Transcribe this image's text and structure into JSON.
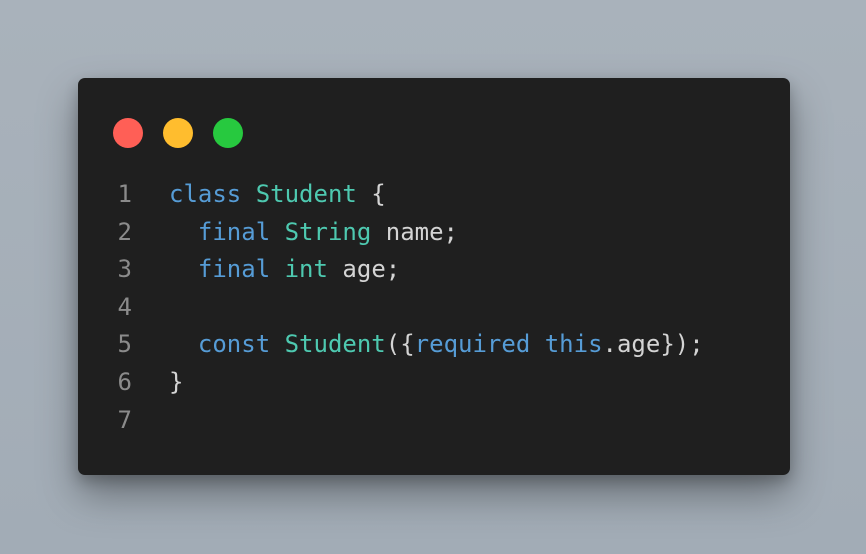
{
  "window": {
    "buttons": [
      {
        "name": "close",
        "color": "#ff5f56"
      },
      {
        "name": "minimize",
        "color": "#ffbd2e"
      },
      {
        "name": "maximize",
        "color": "#27c93f"
      }
    ]
  },
  "colors": {
    "keyword": "#569cd6",
    "type": "#4ec9b0",
    "identifier": "#d4d4d4",
    "line_number": "#8b8b8b",
    "background": "#1f1f1f"
  },
  "code": {
    "lines": [
      {
        "number": "1",
        "tokens": [
          {
            "text": "class",
            "kind": "kw"
          },
          {
            "text": " ",
            "kind": "pn"
          },
          {
            "text": "Student",
            "kind": "ty"
          },
          {
            "text": " {",
            "kind": "pn"
          }
        ]
      },
      {
        "number": "2",
        "tokens": [
          {
            "text": "  ",
            "kind": "pn"
          },
          {
            "text": "final",
            "kind": "kw"
          },
          {
            "text": " ",
            "kind": "pn"
          },
          {
            "text": "String",
            "kind": "ty"
          },
          {
            "text": " name;",
            "kind": "id"
          }
        ]
      },
      {
        "number": "3",
        "tokens": [
          {
            "text": "  ",
            "kind": "pn"
          },
          {
            "text": "final",
            "kind": "kw"
          },
          {
            "text": " ",
            "kind": "pn"
          },
          {
            "text": "int",
            "kind": "ty"
          },
          {
            "text": " age;",
            "kind": "id"
          }
        ]
      },
      {
        "number": "4",
        "tokens": []
      },
      {
        "number": "5",
        "tokens": [
          {
            "text": "  ",
            "kind": "pn"
          },
          {
            "text": "const",
            "kind": "kw"
          },
          {
            "text": " ",
            "kind": "pn"
          },
          {
            "text": "Student",
            "kind": "ty"
          },
          {
            "text": "({",
            "kind": "pn"
          },
          {
            "text": "required",
            "kind": "kw"
          },
          {
            "text": " ",
            "kind": "pn"
          },
          {
            "text": "this",
            "kind": "kw"
          },
          {
            "text": ".age});",
            "kind": "id"
          }
        ]
      },
      {
        "number": "6",
        "tokens": [
          {
            "text": "}",
            "kind": "pn"
          }
        ]
      },
      {
        "number": "7",
        "tokens": []
      }
    ]
  }
}
